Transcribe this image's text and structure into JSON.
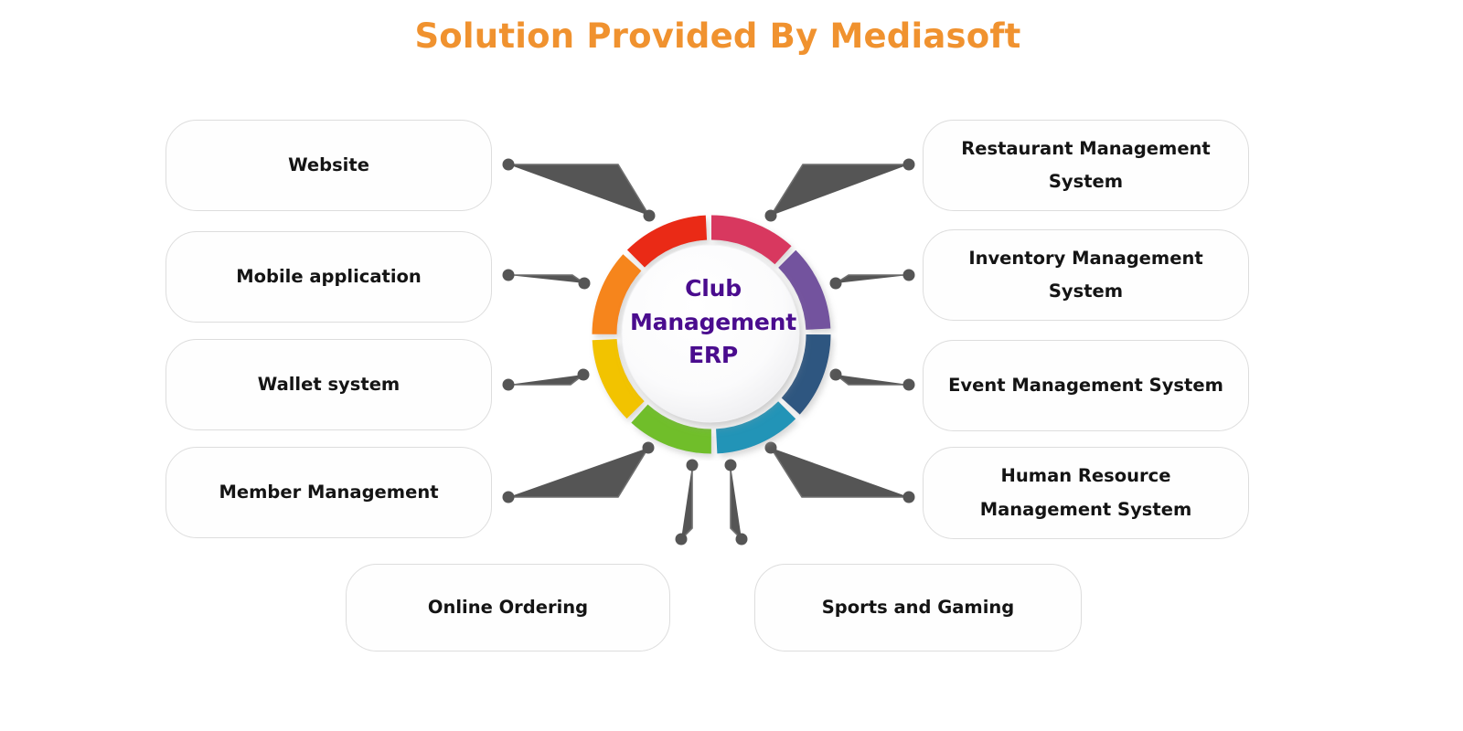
{
  "header": {
    "title": "Solution Provided By Mediasoft",
    "title_color": "#F0922F"
  },
  "hub": {
    "label_line1": "Club",
    "label_line2": "Management",
    "label_line3": "ERP",
    "label_full": "Club Management ERP",
    "text_color": "#4A0C8E"
  },
  "chart_data": {
    "type": "pie",
    "title": "Solution Provided By Mediasoft",
    "center_label": "Club Management ERP",
    "categories": [
      "Restaurant Management System",
      "Inventory Management System",
      "Event Management System",
      "Human Resource Management System",
      "Sports and Gaming",
      "Online Ordering",
      "Member Management",
      "Wallet system",
      "Mobile application",
      "Website"
    ],
    "segment_count": 8,
    "segments": [
      {
        "index": 1,
        "color": "#D8395E",
        "label": "Restaurant Management System"
      },
      {
        "index": 2,
        "color": "#73539E",
        "label": "Inventory Management System"
      },
      {
        "index": 3,
        "color": "#2D5680",
        "label": "Event Management System"
      },
      {
        "index": 4,
        "color": "#2494B7",
        "label": "Human Resource Management System"
      },
      {
        "index": 5,
        "color": "#6FBE2A",
        "label": "Online Ordering"
      },
      {
        "index": 6,
        "color": "#F2C300",
        "label": "Wallet system"
      },
      {
        "index": 7,
        "color": "#F6851E",
        "label": "Mobile application"
      },
      {
        "index": 8,
        "color": "#EA2A18",
        "label": "Website"
      }
    ],
    "values": [
      12.5,
      12.5,
      12.5,
      12.5,
      12.5,
      12.5,
      12.5,
      12.5
    ],
    "legend_position": "around",
    "grid": false
  },
  "nodes": {
    "left": [
      {
        "label": "Website"
      },
      {
        "label": "Mobile application"
      },
      {
        "label": "Wallet system"
      },
      {
        "label": "Member Management"
      }
    ],
    "right": [
      {
        "label": "Restaurant Management System"
      },
      {
        "label": "Inventory Management System"
      },
      {
        "label": "Event Management System"
      },
      {
        "label": "Human Resource Management System"
      }
    ],
    "bottom": [
      {
        "label": "Online Ordering"
      },
      {
        "label": "Sports and Gaming"
      }
    ]
  },
  "style": {
    "connector_color": "#555555",
    "card_border": "#dddddd",
    "background": "#ffffff"
  }
}
